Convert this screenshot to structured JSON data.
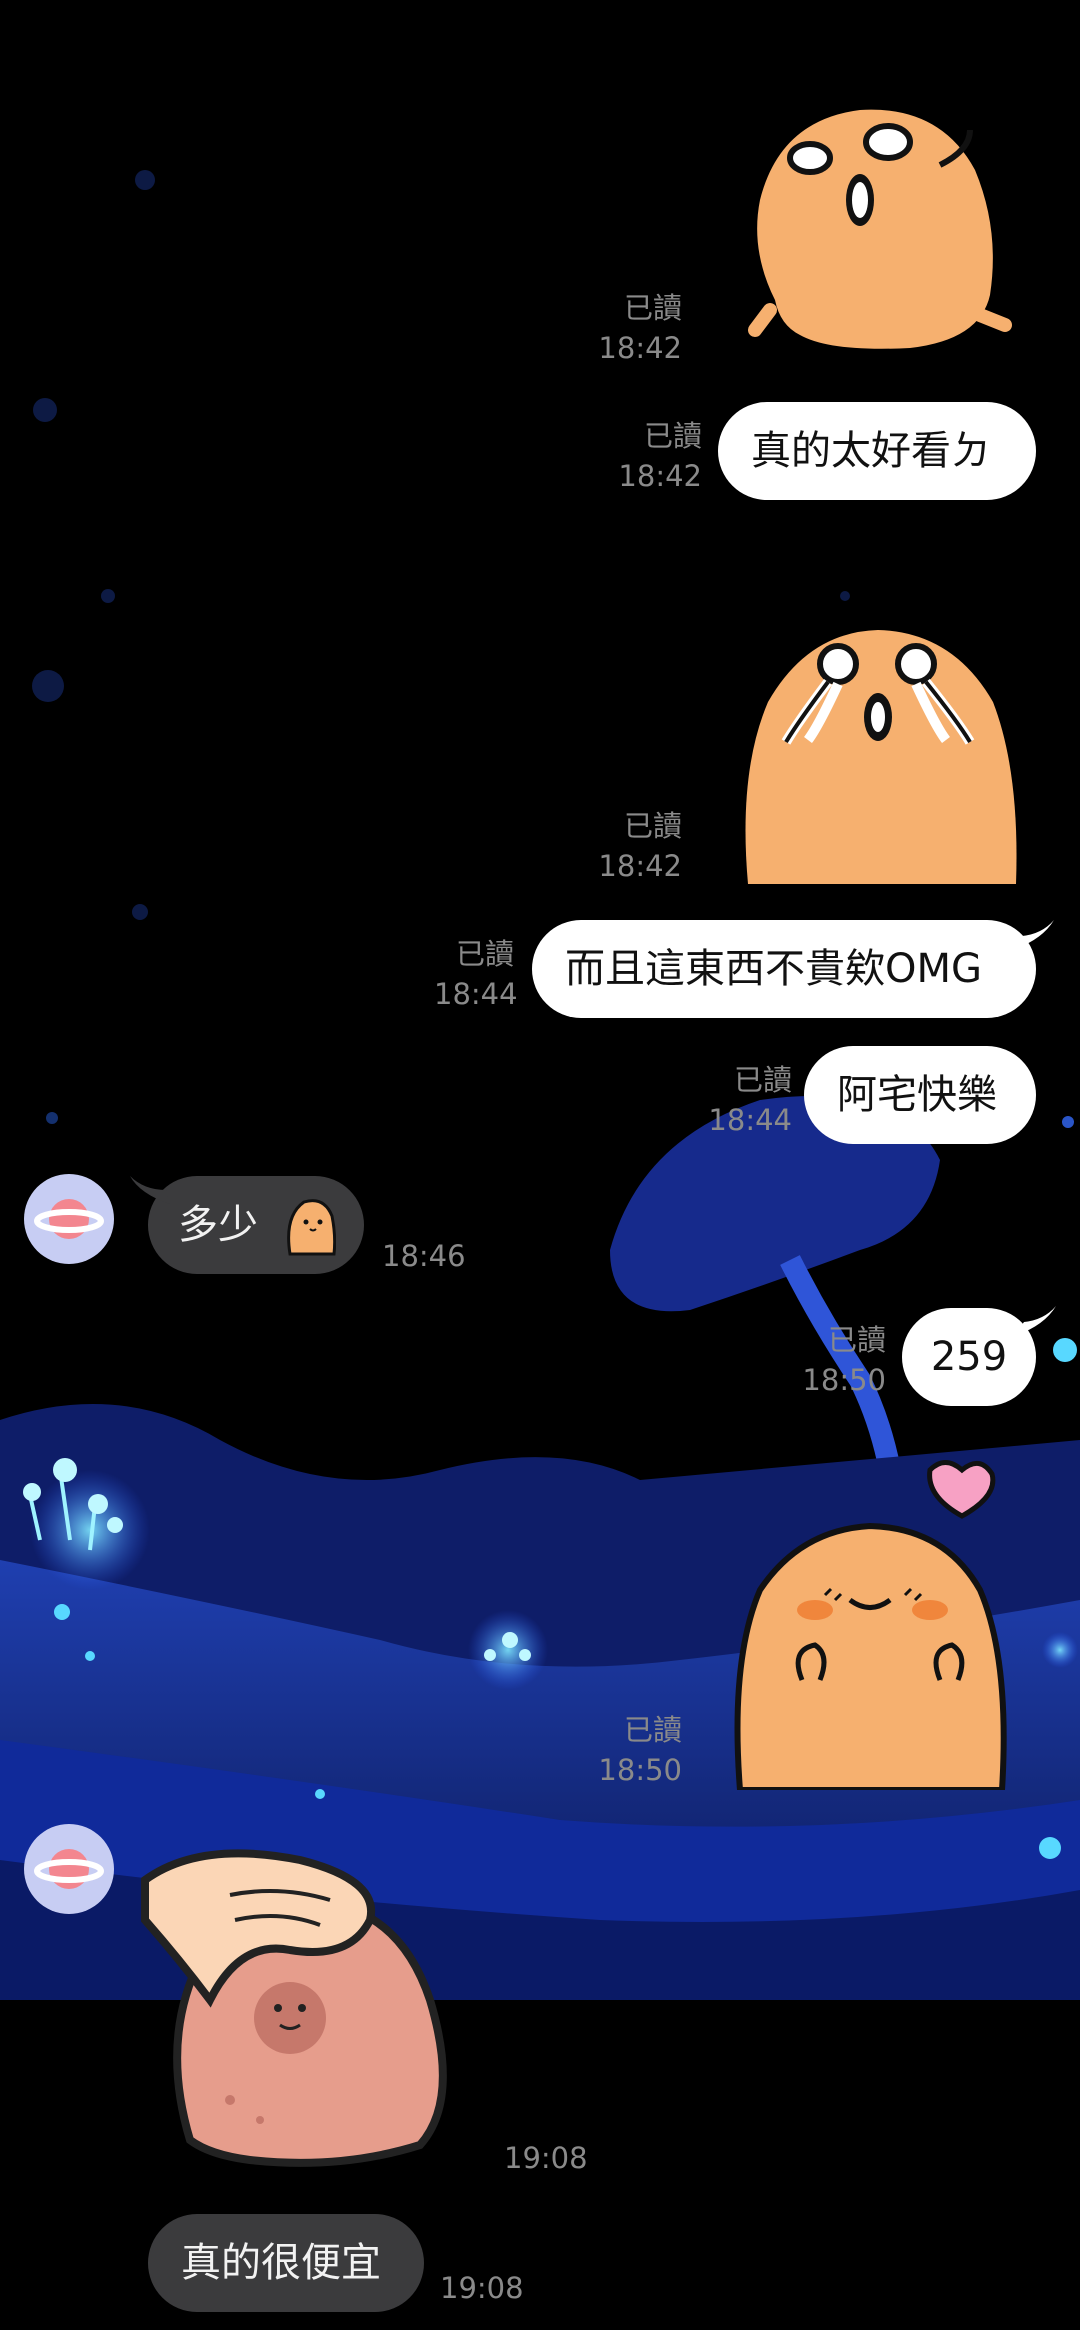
{
  "messages": [
    {
      "type": "sticker",
      "side": "out",
      "sticker": "crying-potato-sticker",
      "read": "已讀",
      "time": "18:42"
    },
    {
      "type": "text",
      "side": "out",
      "text": "真的太好看ㄉ",
      "read": "已讀",
      "time": "18:42"
    },
    {
      "type": "sticker",
      "side": "out",
      "sticker": "tearful-potato-sticker",
      "read": "已讀",
      "time": "18:42"
    },
    {
      "type": "text",
      "side": "out",
      "text": "而且這東西不貴欸OMG",
      "read": "已讀",
      "time": "18:44"
    },
    {
      "type": "text",
      "side": "out",
      "text": "阿宅快樂",
      "read": "已讀",
      "time": "18:44"
    },
    {
      "type": "text",
      "side": "in",
      "text": "多少",
      "emoji": "potato-emoji",
      "time": "18:46"
    },
    {
      "type": "text",
      "side": "out",
      "text": "259",
      "read": "已讀",
      "time": "18:50"
    },
    {
      "type": "sticker",
      "side": "out",
      "sticker": "blushing-potato-heart-sticker",
      "read": "已讀",
      "time": "18:50"
    },
    {
      "type": "sticker",
      "side": "in",
      "sticker": "head-pat-bear-sticker",
      "time": "19:08"
    },
    {
      "type": "text",
      "side": "in",
      "text": "真的很便宜",
      "time": "19:08"
    }
  ],
  "contact": {
    "avatar_icon": "planet-icon",
    "avatar_color": "#c7cdf3"
  },
  "colors": {
    "background": "#000000",
    "outgoing_bubble": "#ffffff",
    "incoming_bubble": "#3b3b3d",
    "meta_text": "#8a8a8a",
    "potato": "#f6b06f",
    "wallpaper_blue": "#1b2f8a"
  }
}
